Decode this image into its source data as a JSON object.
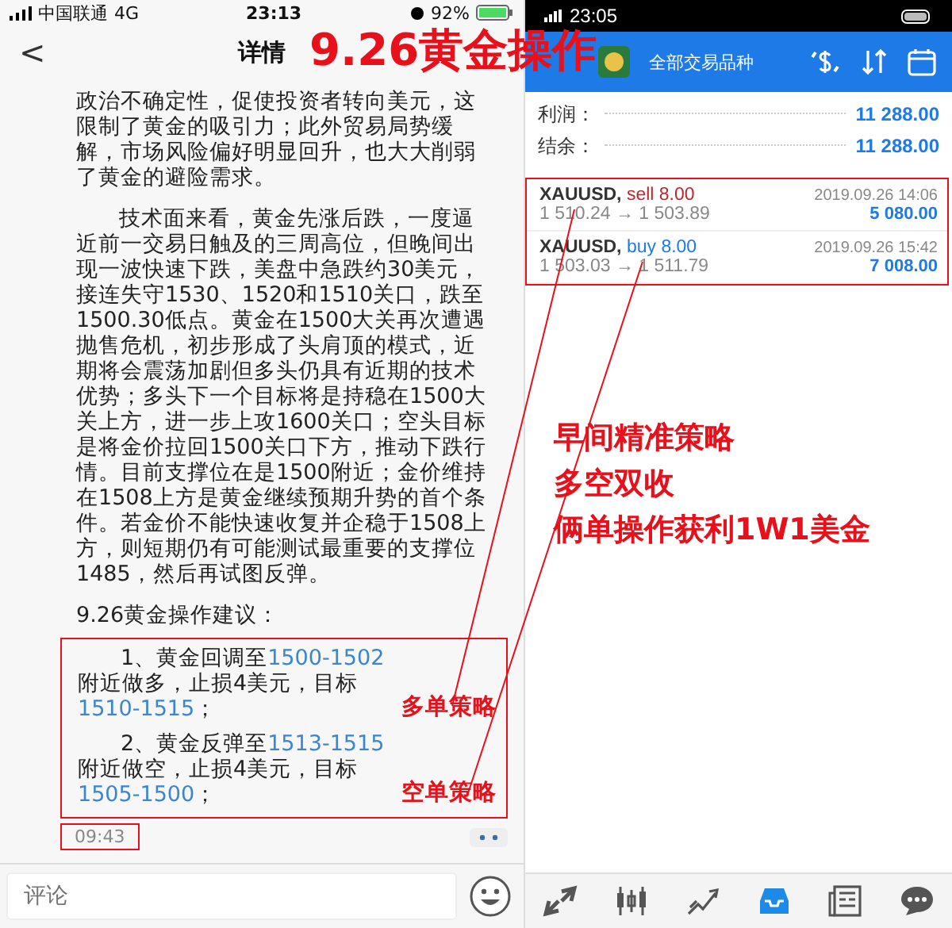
{
  "overlay_title": "9.26黄金操作",
  "left_phone": {
    "status_bar": {
      "carrier": "中国联通",
      "network": "4G",
      "time": "23:13",
      "battery": "92%"
    },
    "nav": {
      "back": "<",
      "title": "详情"
    },
    "paragraphs": [
      {
        "text": "政治不确定性，促使投资者转向美元，这限制了黄金的吸引力；此外贸易局势缓解，市场风险偏好明显回升，也大大削弱了黄金的避险需求。",
        "indent": false
      },
      {
        "text": "技术面来看，黄金先涨后跌，一度逼近前一交易日触及的三周高位，但晚间出现一波快速下跌，美盘中急跌约30美元，接连失守1530、1520和1510关口，跌至1500.30低点。黄金在1500大关再次遭遇抛售危机，初步形成了头肩顶的模式，近期将会震荡加剧但多头仍具有近期的技术优势；多头下一个目标将是持稳在1500大关上方，进一步上攻1600关口；空头目标是将金价拉回1500关口下方，推动下跌行情。目前支撑位在是1500附近；金价维持在1508上方是黄金继续预期升势的首个条件。若金价不能快速收复并企稳于1508上方，则短期仍有可能测试最重要的支撑位1485，然后再试图反弹。",
        "indent": true
      },
      {
        "text": "9.26黄金操作建议：",
        "indent": false
      }
    ],
    "advice": [
      {
        "parts": [
          {
            "text": "1、黄金回调至",
            "kind": "plain"
          },
          {
            "text": "1500-1502",
            "kind": "highlight"
          },
          {
            "text": "附近做多，止损4美元，目标",
            "kind": "plain"
          },
          {
            "text": "1510-1515",
            "kind": "highlight"
          },
          {
            "text": "；",
            "kind": "plain"
          }
        ],
        "annotation": "多单策略"
      },
      {
        "parts": [
          {
            "text": "2、黄金反弹至",
            "kind": "plain"
          },
          {
            "text": "1513-1515",
            "kind": "highlight"
          },
          {
            "text": "附近做空，止损4美元，目标",
            "kind": "plain"
          },
          {
            "text": "1505-1500",
            "kind": "highlight"
          },
          {
            "text": "；",
            "kind": "plain"
          }
        ],
        "annotation": "空单策略"
      }
    ],
    "time": "09:43",
    "comment": {
      "placeholder": "评论"
    }
  },
  "right_phone": {
    "status_bar": {
      "time": "23:05"
    },
    "header": {
      "subtitle": "全部交易品种"
    },
    "summary": [
      {
        "label": "利润：",
        "value": "11 288.00"
      },
      {
        "label": "结余：",
        "value": "11 288.00"
      }
    ],
    "trades": [
      {
        "symbol": "XAUUSD,",
        "kind": "sell",
        "order": "sell 8.00",
        "prices": "1 510.24 → 1 503.89",
        "date": "2019.09.26 14:06",
        "profit": "5 080.00"
      },
      {
        "symbol": "XAUUSD,",
        "kind": "buy",
        "order": "buy 8.00",
        "prices": "1 503.03 → 1 511.79",
        "date": "2019.09.26 15:42",
        "profit": "7 008.00"
      }
    ],
    "annotations": [
      "早间精准策略",
      "多空双收",
      "俩单操作获利1W1美金"
    ],
    "tabs": [
      {
        "kind": "quotes",
        "selected": false
      },
      {
        "kind": "chart",
        "selected": false
      },
      {
        "kind": "trade",
        "selected": false
      },
      {
        "kind": "history",
        "selected": true
      },
      {
        "kind": "news",
        "selected": false
      },
      {
        "kind": "chat",
        "selected": false
      }
    ]
  }
}
